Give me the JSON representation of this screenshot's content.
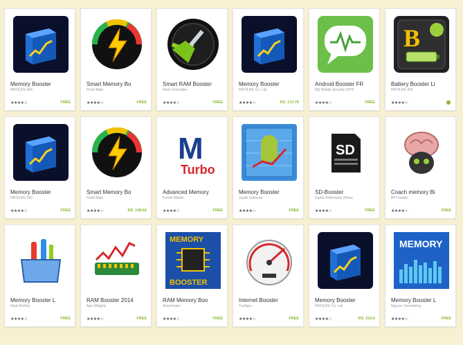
{
  "apps": [
    {
      "title": "Memory Booster",
      "developer": "INFOLIFE INC",
      "stars": "★★★★☆",
      "price": "FREE",
      "icon": "memory-booster-cube-icon",
      "has_price_dot": false
    },
    {
      "title": "Smart Memory Bo",
      "developer": "Droid Mate",
      "stars": "★★★★☆",
      "price": "FREE",
      "icon": "lightning-gauge-icon",
      "has_price_dot": false
    },
    {
      "title": "Smart RAM Booster",
      "developer": "Root Uninstaller",
      "stars": "★★★★☆",
      "price": "FREE",
      "icon": "broom-circle-icon",
      "has_price_dot": false
    },
    {
      "title": "Memory Booster",
      "developer": "INFOLIFE Co. Ltd",
      "stars": "★★★★☆",
      "price": "RS. 172.79",
      "icon": "memory-booster-cube-icon",
      "has_price_dot": false
    },
    {
      "title": "Android Booster FR",
      "developer": "NQ Mobile Security (NYS",
      "stars": "★★★★☆",
      "price": "FREE",
      "icon": "android-booster-chat-icon",
      "has_price_dot": false
    },
    {
      "title": "Battery Booster Li",
      "developer": "INFOLIFE INC",
      "stars": "★★★★☆",
      "price": "",
      "icon": "battery-booster-icon",
      "has_price_dot": true
    },
    {
      "title": "Memory Booster",
      "developer": "INFOLIFE INC",
      "stars": "★★★★☆",
      "price": "FREE",
      "icon": "memory-booster-cube-icon",
      "has_price_dot": false
    },
    {
      "title": "Smart Memory Bo",
      "developer": "Droid Mate",
      "stars": "★★★★☆",
      "price": "RS. 108.64",
      "icon": "lightning-gauge-icon",
      "has_price_dot": false
    },
    {
      "title": "Advanced Memory",
      "developer": "Kernel Master",
      "stars": "★★★★☆",
      "price": "FREE",
      "icon": "m-turbo-icon",
      "has_price_dot": false
    },
    {
      "title": "Memory Booster",
      "developer": "Jayde Software",
      "stars": "★★★★☆",
      "price": "FREE",
      "icon": "android-chart-icon",
      "has_price_dot": false
    },
    {
      "title": "SD-Booster",
      "developer": "Daniel Mohrmann (Mous",
      "stars": "★★★★☆",
      "price": "FREE",
      "icon": "sd-card-icon",
      "has_price_dot": false
    },
    {
      "title": "Coach memory Bi",
      "developer": "BPI mobile",
      "stars": "★★★★☆",
      "price": "FREE",
      "icon": "brain-cat-icon",
      "has_price_dot": false
    },
    {
      "title": "Memory Booster L",
      "developer": "Dash Bodhis",
      "stars": "★★★★☆",
      "price": "FREE",
      "icon": "toolbox-icon",
      "has_price_dot": false
    },
    {
      "title": "RAM Booster 2014",
      "developer": "Apo Widgets",
      "stars": "★★★★☆",
      "price": "FREE",
      "icon": "ram-chart-icon",
      "has_price_dot": false
    },
    {
      "title": "RAM Memory Boo",
      "developer": "Antonhoper",
      "stars": "★★★★☆",
      "price": "FREE",
      "icon": "memory-booster-chip-icon",
      "has_price_dot": false
    },
    {
      "title": "Internet Booster",
      "developer": "TruApps",
      "stars": "★★★★☆",
      "price": "FREE",
      "icon": "speedometer-icon",
      "has_price_dot": false
    },
    {
      "title": "Memory Booster",
      "developer": "INFOLIFE Co. Ltd",
      "stars": "★★★★☆",
      "price": "RS. 210.6",
      "icon": "memory-booster-cube-icon",
      "has_price_dot": false
    },
    {
      "title": "Memory Booster L",
      "developer": "Nguyen Senatisting",
      "stars": "★★★★☆",
      "price": "FREE",
      "icon": "memory-bars-icon",
      "has_price_dot": false
    }
  ],
  "icon_text": {
    "m_turbo_letter": "M",
    "m_turbo_word": "Turbo",
    "sd_label": "SD",
    "battery_letter": "B",
    "chip_top": "MEMORY",
    "chip_bottom": "BOOSTER",
    "bars_title": "MEMORY"
  },
  "colors": {
    "page_bg": "#f7f0d2",
    "price_green": "#8ab833"
  }
}
